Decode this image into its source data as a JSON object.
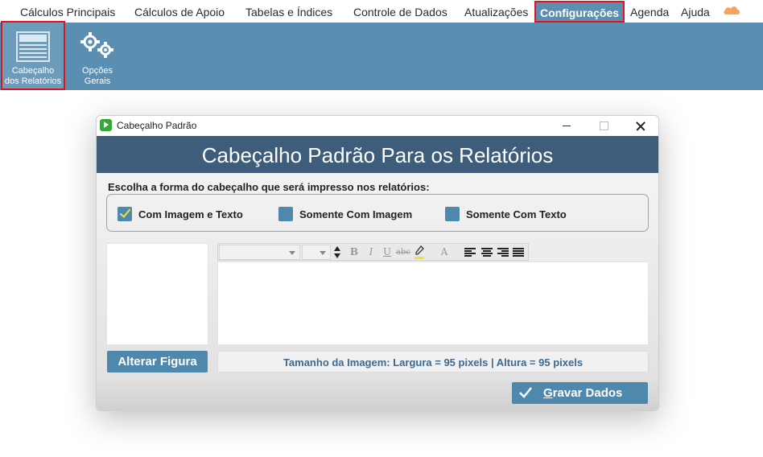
{
  "menu": {
    "items": [
      {
        "label": "Cálculos Principais"
      },
      {
        "label": "Cálculos de Apoio"
      },
      {
        "label": "Tabelas e Índices"
      },
      {
        "label": "Controle de Dados"
      },
      {
        "label": "Atualizações"
      },
      {
        "label": "Configurações",
        "active": true
      },
      {
        "label": "Agenda"
      },
      {
        "label": "Ajuda"
      }
    ],
    "cloud_icon": "cloud-icon"
  },
  "ribbon": {
    "buttons": [
      {
        "line1": "Cabeçalho",
        "line2": "dos Relatórios",
        "icon": "header-layout-icon",
        "selected": true
      },
      {
        "line1": "Opções",
        "line2": "Gerais",
        "icon": "gears-icon"
      }
    ]
  },
  "dialog": {
    "title": "Cabeçalho Padrão",
    "banner": "Cabeçalho Padrão Para os Relatórios",
    "choose_label": "Escolha a forma do cabeçalho que será impresso nos relatórios:",
    "options": [
      {
        "label": "Com Imagem e Texto",
        "checked": true
      },
      {
        "label": "Somente Com Imagem",
        "checked": false
      },
      {
        "label": "Somente Com Texto",
        "checked": false
      }
    ],
    "toolbar": {
      "bold": "B",
      "italic": "I",
      "underline": "U",
      "strike": "abc",
      "font_color": "A"
    },
    "alter_button": "Alterar Figura",
    "size_info": "Tamanho da Imagem: Largura = 95 pixels | Altura = 95 pixels",
    "save_button": {
      "accel": "G",
      "rest": "ravar Dados"
    }
  },
  "colors": {
    "ribbon": "#5a8fb1",
    "banner": "#3d5d7b",
    "button": "#4e89ad",
    "highlight": "#e0121e"
  }
}
